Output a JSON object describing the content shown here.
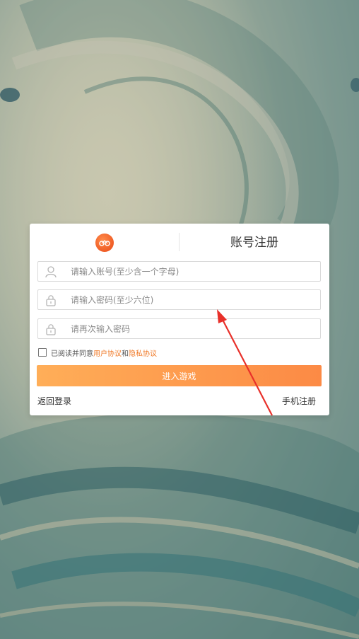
{
  "register": {
    "title": "账号注册",
    "account_placeholder": "请输入账号(至少含一个字母)",
    "password_placeholder": "请输入密码(至少六位)",
    "confirm_placeholder": "请再次输入密码",
    "agree_prefix": "已阅读并同意",
    "user_agreement": "用户协议",
    "agree_and": "和",
    "privacy_agreement": "隐私协议",
    "enter_button": "进入游戏",
    "back_login": "返回登录",
    "phone_register": "手机注册"
  },
  "colors": {
    "accent": "#fc8a45",
    "link": "#f07a28",
    "annotation_arrow": "#e8302a"
  },
  "icons": [
    "logo-icon",
    "user-icon",
    "lock-icon",
    "lock-icon",
    "checkbox-icon"
  ]
}
